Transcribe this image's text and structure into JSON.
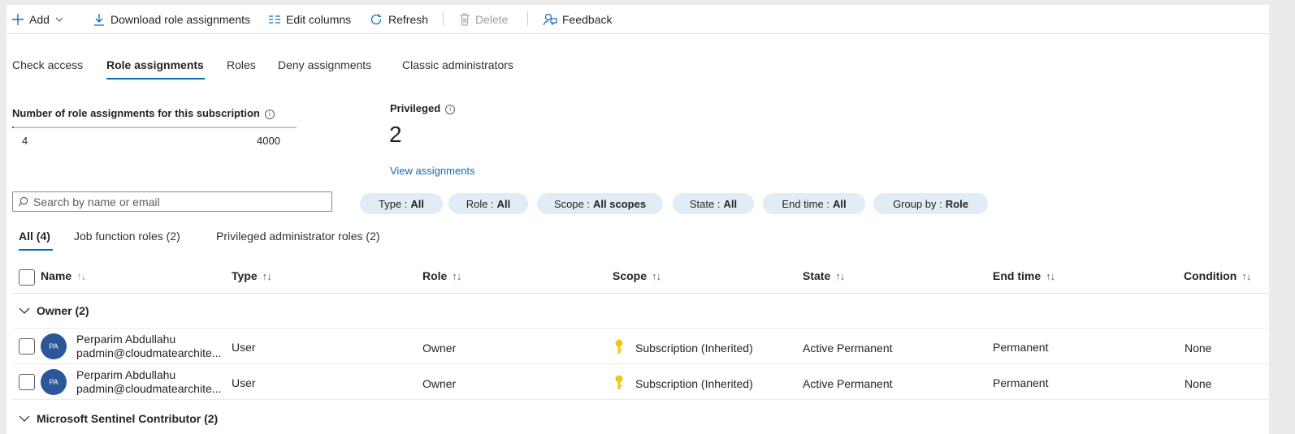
{
  "toolbar": {
    "add": "Add",
    "download": "Download role assignments",
    "edit_columns": "Edit columns",
    "refresh": "Refresh",
    "delete": "Delete",
    "feedback": "Feedback"
  },
  "tabs": [
    "Check access",
    "Role assignments",
    "Roles",
    "Deny assignments",
    "Classic administrators"
  ],
  "active_tab": "Role assignments",
  "summary": {
    "count_label": "Number of role assignments for this subscription",
    "current": "4",
    "max": "4000",
    "privileged_label": "Privileged",
    "privileged_value": "2",
    "view_link": "View assignments",
    "usage_fraction": 0.001
  },
  "search": {
    "placeholder": "Search by name or email"
  },
  "filters": [
    {
      "key": "Type :",
      "value": "All"
    },
    {
      "key": "Role :",
      "value": "All"
    },
    {
      "key": "Scope :",
      "value": "All scopes"
    },
    {
      "key": "State :",
      "value": "All"
    },
    {
      "key": "End time :",
      "value": "All"
    },
    {
      "key": "Group by :",
      "value": "Role"
    }
  ],
  "subtabs": [
    "All (4)",
    "Job function roles (2)",
    "Privileged administrator roles (2)"
  ],
  "columns": [
    "Name",
    "Type",
    "Role",
    "Scope",
    "State",
    "End time",
    "Condition"
  ],
  "sort_glyph": "↑↓",
  "groups": [
    {
      "label": "Owner (2)",
      "rows": [
        {
          "initials": "PA",
          "name": "Perparim Abdullahu",
          "email": "padmin@cloudmatearchite...",
          "type": "User",
          "role": "Owner",
          "scope": "Subscription (Inherited)",
          "state": "Active Permanent",
          "end_time": "Permanent",
          "condition": "None"
        },
        {
          "initials": "PA",
          "name": "Perparim Abdullahu",
          "email": "padmin@cloudmatearchite...",
          "type": "User",
          "role": "Owner",
          "scope": "Subscription (Inherited)",
          "state": "Active Permanent",
          "end_time": "Permanent",
          "condition": "None"
        }
      ]
    },
    {
      "label": "Microsoft Sentinel Contributor (2)",
      "rows": []
    }
  ],
  "colors": {
    "accent": "#0f6cbd",
    "pill_bg": "#e1ecf7",
    "avatar_bg": "#2b579a",
    "key_icon": "#f2c811"
  }
}
